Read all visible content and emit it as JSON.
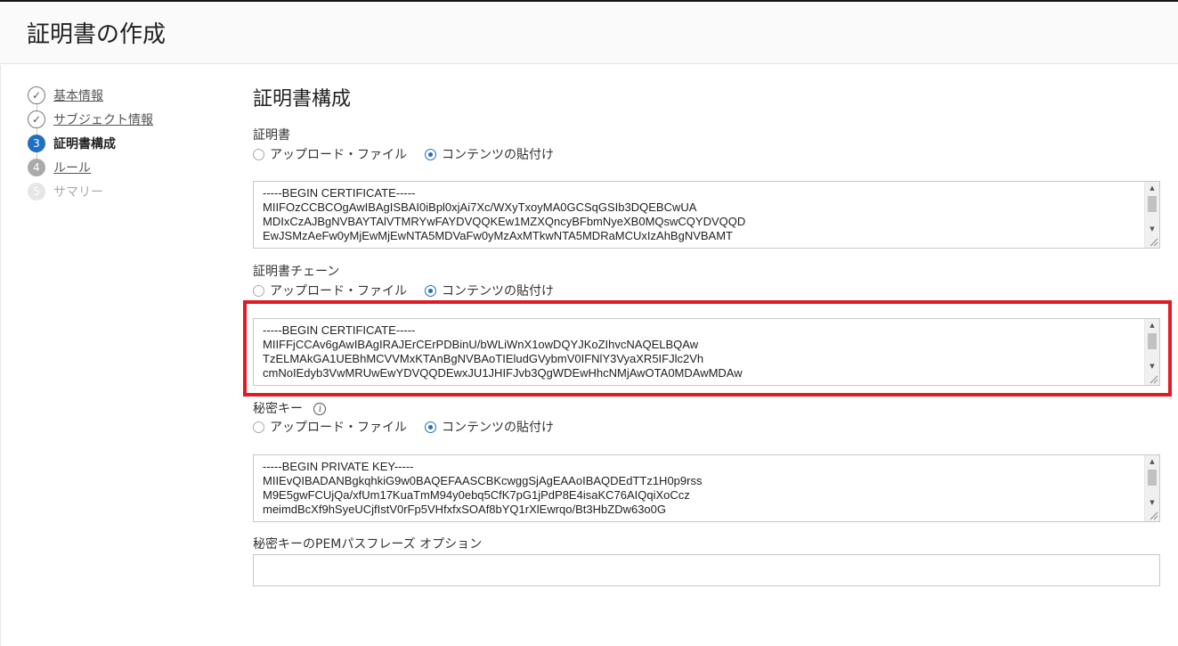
{
  "header": {
    "title": "証明書の作成"
  },
  "steps": [
    {
      "num": "✓",
      "label": "基本情報",
      "state": "done"
    },
    {
      "num": "✓",
      "label": "サブジェクト情報",
      "state": "done"
    },
    {
      "num": "3",
      "label": "証明書構成",
      "state": "current"
    },
    {
      "num": "4",
      "label": "ルール",
      "state": "next"
    },
    {
      "num": "5",
      "label": "サマリー",
      "state": "future"
    }
  ],
  "section": {
    "title": "証明書構成"
  },
  "certificate": {
    "label": "証明書",
    "option_upload": "アップロード・ファイル",
    "option_paste": "コンテンツの貼付け",
    "content": "-----BEGIN CERTIFICATE-----\nMIIFOzCCBCOgAwIBAgISBAI0iBpl0xjAi7Xc/WXyTxoyMA0GCSqGSIb3DQEBCwUA\nMDIxCzAJBgNVBAYTAlVTMRYwFAYDVQQKEw1MZXQncyBFbmNyeXB0MQswCQYDVQQD\nEwJSMzAeFw0yMjEwMjEwNTA5MDVaFw0yMzAxMTkwNTA5MDRaMCUxIzAhBgNVBAMT"
  },
  "chain": {
    "label": "証明書チェーン",
    "option_upload": "アップロード・ファイル",
    "option_paste": "コンテンツの貼付け",
    "content": "-----BEGIN CERTIFICATE-----\nMIIFFjCCAv6gAwIBAgIRAJErCErPDBinU/bWLiWnX1owDQYJKoZIhvcNAQELBQAw\nTzELMAkGA1UEBhMCVVMxKTAnBgNVBAoTIEludGVybmV0IFNlY3VyaXR5IFJlc2Vh\ncmNoIEdyb3VwMRUwEwYDVQQDEwxJU1JHIFJvb3QgWDEwHhcNMjAwOTA0MDAwMDAw"
  },
  "private_key": {
    "label": "秘密キー",
    "info": "i",
    "option_upload": "アップロード・ファイル",
    "option_paste": "コンテンツの貼付け",
    "content": "-----BEGIN PRIVATE KEY-----\nMIIEvQIBADANBgkqhkiG9w0BAQEFAASCBKcwggSjAgEAAoIBAQDEdTTz1H0p9rss\nM9E5gwFCUjQa/xfUm17KuaTmM94y0ebq5CfK7pG1jPdP8E4isaKC76AIQqiXoCcz\nmeimdBcXf9hSyeUCjfIstV0rFp5VHfxfxSOAf8bYQ1rXlEwrqo/Bt3HbZDw63o0G"
  },
  "passphrase": {
    "label": "秘密キーのPEMパスフレーズ  オプション",
    "value": ""
  },
  "colors": {
    "accent": "#1f70c1",
    "highlight": "#e21b23"
  }
}
